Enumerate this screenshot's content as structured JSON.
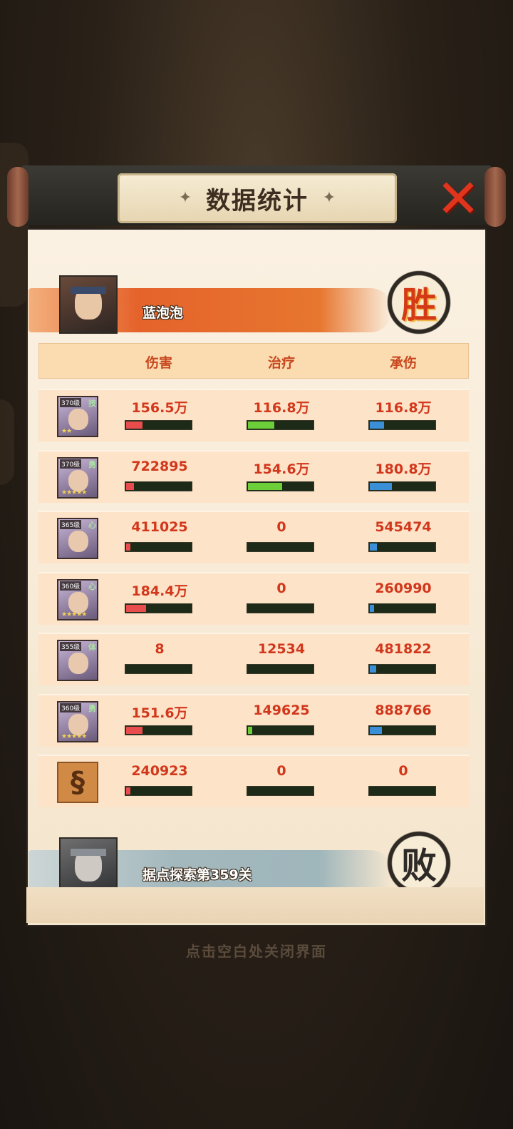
{
  "title": "数据统计",
  "close_icon": "close-x-icon",
  "colors": {
    "damage": "#e94c4c",
    "heal": "#6ccf3a",
    "taken": "#3b8fd6",
    "accent": "#d2371b"
  },
  "win_team": {
    "name": "蓝泡泡",
    "result": "胜"
  },
  "lose_team": {
    "name": "据点探索第359关",
    "result": "败"
  },
  "columns": [
    "伤害",
    "治疗",
    "承伤"
  ],
  "rows": [
    {
      "level": "370级",
      "cls": "技",
      "stars": "★★",
      "damage": "156.5万",
      "heal": "116.8万",
      "taken": "116.8万",
      "damage_ratio": 0.25,
      "heal_ratio": 0.4,
      "taken_ratio": 0.22
    },
    {
      "level": "370级",
      "cls": "勇",
      "stars": "★★★★★",
      "damage": "722895",
      "heal": "154.6万",
      "taken": "180.8万",
      "damage_ratio": 0.12,
      "heal_ratio": 0.52,
      "taken_ratio": 0.33
    },
    {
      "level": "365级",
      "cls": "心",
      "stars": "",
      "damage": "411025",
      "heal": "0",
      "taken": "545474",
      "damage_ratio": 0.06,
      "heal_ratio": 0,
      "taken_ratio": 0.11
    },
    {
      "level": "360级",
      "cls": "心",
      "stars": "★★★★★",
      "damage": "184.4万",
      "heal": "0",
      "taken": "260990",
      "damage_ratio": 0.3,
      "heal_ratio": 0,
      "taken_ratio": 0.06
    },
    {
      "level": "355级",
      "cls": "体",
      "stars": "",
      "damage": "8",
      "heal": "12534",
      "taken": "481822",
      "damage_ratio": 0,
      "heal_ratio": 0,
      "taken_ratio": 0.1
    },
    {
      "level": "360级",
      "cls": "勇",
      "stars": "★★★★★",
      "damage": "151.6万",
      "heal": "149625",
      "taken": "888766",
      "damage_ratio": 0.25,
      "heal_ratio": 0.06,
      "taken_ratio": 0.18
    },
    {
      "level": "",
      "cls": "",
      "stars": "",
      "damage": "240923",
      "heal": "0",
      "taken": "0",
      "damage_ratio": 0.06,
      "heal_ratio": 0,
      "taken_ratio": 0,
      "scroll": true
    }
  ],
  "footer_hint": "点击空白处关闭界面"
}
